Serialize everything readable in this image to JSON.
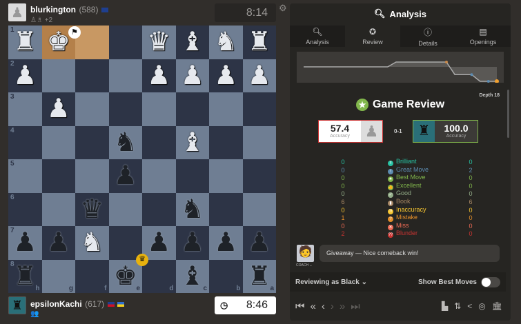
{
  "top_player": {
    "name": "blurkington",
    "rating": "(588)",
    "flag": "AU",
    "captured_extra": "+2",
    "captured": [
      "♙",
      "♗"
    ],
    "clock": "8:14"
  },
  "bottom_player": {
    "name": "epsilonKachi",
    "rating": "(617)",
    "flags": [
      "PH",
      "UA"
    ],
    "clock": "8:46"
  },
  "board": {
    "orientation": "black",
    "files": [
      "h",
      "g",
      "f",
      "e",
      "d",
      "c",
      "b",
      "a"
    ],
    "ranks": [
      "1",
      "2",
      "3",
      "4",
      "5",
      "6",
      "7",
      "8"
    ],
    "rows": [
      [
        "wR",
        "wK",
        "",
        "",
        "wQ",
        "wB",
        "wN",
        "wR"
      ],
      [
        "wP",
        "",
        "",
        "",
        "wP",
        "wP",
        "wP",
        "wP"
      ],
      [
        "",
        "wP",
        "",
        "",
        "",
        "",
        "",
        ""
      ],
      [
        "",
        "",
        "",
        "bN",
        "",
        "wB",
        "",
        ""
      ],
      [
        "",
        "",
        "",
        "bP",
        "",
        "",
        "",
        ""
      ],
      [
        "",
        "",
        "bQ",
        "",
        "",
        "bN",
        "",
        ""
      ],
      [
        "bP",
        "bP",
        "wN",
        "",
        "bP",
        "bP",
        "bP",
        "bP"
      ],
      [
        "bR",
        "",
        "",
        "bK",
        "",
        "bB",
        "",
        "bR"
      ]
    ],
    "highlight": [
      "g1",
      "f1"
    ],
    "flag_badge_square": "g1",
    "crown_badge_square": "e8",
    "colors": {
      "light": "#6f7e93",
      "dark": "#2d3446",
      "highlight": "#b4804a"
    }
  },
  "panel": {
    "title": "Analysis",
    "tabs": [
      {
        "label": "Analysis",
        "icon": "analysis-icon"
      },
      {
        "label": "Review",
        "icon": "star-icon"
      },
      {
        "label": "Details",
        "icon": "info-icon"
      },
      {
        "label": "Openings",
        "icon": "book-icon"
      }
    ],
    "active_tab": "Review",
    "eval_graph": [
      0,
      0,
      0,
      0,
      0,
      0,
      0,
      0,
      0,
      0,
      0,
      0.5,
      0.5,
      0.5,
      0.5,
      0.5,
      0.5,
      0.5,
      -0.8,
      -0.8,
      -0.8,
      -1.5,
      -1.5,
      -1.5
    ],
    "depth": "Depth 18",
    "review_title": "Game Review",
    "white_accuracy": "57.4",
    "black_accuracy": "100.0",
    "accuracy_label": "Accuracy",
    "result": "0-1",
    "stats": [
      {
        "label": "Brilliant",
        "white": "0",
        "black": "0",
        "color": "#26c2a3",
        "sym": "!!"
      },
      {
        "label": "Great Move",
        "white": "0",
        "black": "2",
        "color": "#5c8bb0",
        "sym": "!"
      },
      {
        "label": "Best Move",
        "white": "0",
        "black": "0",
        "color": "#81b64c",
        "sym": "★"
      },
      {
        "label": "Excellent",
        "white": "0",
        "black": "0",
        "color": "#81b64c",
        "sym": "👍"
      },
      {
        "label": "Good",
        "white": "0",
        "black": "0",
        "color": "#95af8a",
        "sym": "✓"
      },
      {
        "label": "Book",
        "white": "6",
        "black": "6",
        "color": "#a88865",
        "sym": "▮"
      },
      {
        "label": "Inaccuracy",
        "white": "0",
        "black": "0",
        "color": "#f7c631",
        "sym": "?!"
      },
      {
        "label": "Mistake",
        "white": "1",
        "black": "0",
        "color": "#e58f2a",
        "sym": "?"
      },
      {
        "label": "Miss",
        "white": "0",
        "black": "0",
        "color": "#ee6b55",
        "sym": "✕"
      },
      {
        "label": "Blunder",
        "white": "2",
        "black": "0",
        "color": "#ca3431",
        "sym": "??"
      }
    ],
    "coach_label": "COACH",
    "coach_message": "Giveaway — Nice comeback win!",
    "reviewing_as": "Reviewing as Black",
    "show_best_moves": "Show Best Moves",
    "show_best_moves_on": false
  }
}
